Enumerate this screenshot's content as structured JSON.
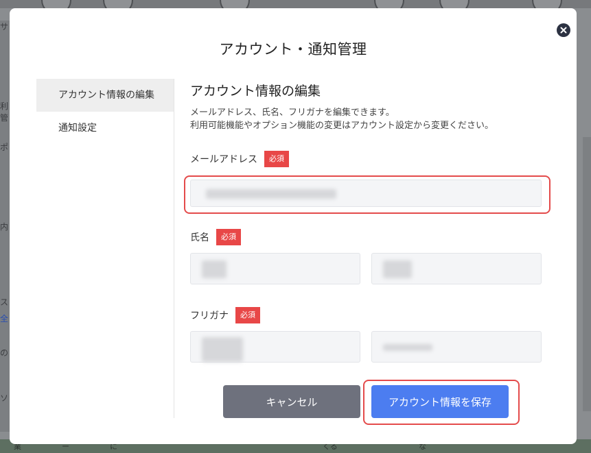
{
  "background": {
    "left_fragments": [
      "サ",
      "利管",
      "ポ",
      "内",
      "ス",
      "全",
      "の",
      "ソ"
    ],
    "bottom_fragments": [
      "業",
      "ー",
      "に",
      "くる",
      "な"
    ]
  },
  "modal": {
    "title": "アカウント・通知管理",
    "close_icon": "close-icon"
  },
  "sidebar": {
    "items": [
      {
        "label": "アカウント情報の編集",
        "active": true
      },
      {
        "label": "通知設定",
        "active": false
      }
    ]
  },
  "form": {
    "section_title": "アカウント情報の編集",
    "description_line1": "メールアドレス、氏名、フリガナを編集できます。",
    "description_line2": "利用可能機能やオプション機能の変更はアカウント設定から変更ください。",
    "required_badge": "必須",
    "email_label": "メールアドレス",
    "name_label": "氏名",
    "furigana_label": "フリガナ"
  },
  "buttons": {
    "cancel": "キャンセル",
    "save": "アカウント情報を保存"
  },
  "colors": {
    "required_badge": "#e84747",
    "save_button": "#4c7df0",
    "cancel_button": "#6e717d",
    "highlight": "#e44a4a"
  }
}
